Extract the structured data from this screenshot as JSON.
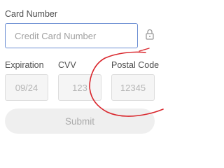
{
  "form": {
    "card_number_label": "Card Number",
    "card_number_placeholder": "Credit Card Number",
    "expiration_label": "Expiration",
    "expiration_placeholder": "09/24",
    "cvv_label": "CVV",
    "cvv_placeholder": "123",
    "postal_code_label": "Postal Code",
    "postal_code_placeholder": "12345",
    "submit_label": "Submit"
  },
  "icons": {
    "lock": "lock-icon"
  },
  "colors": {
    "focus_border": "#6d8fd3",
    "annotation": "#d9262c",
    "submit_bg": "#efefef"
  }
}
